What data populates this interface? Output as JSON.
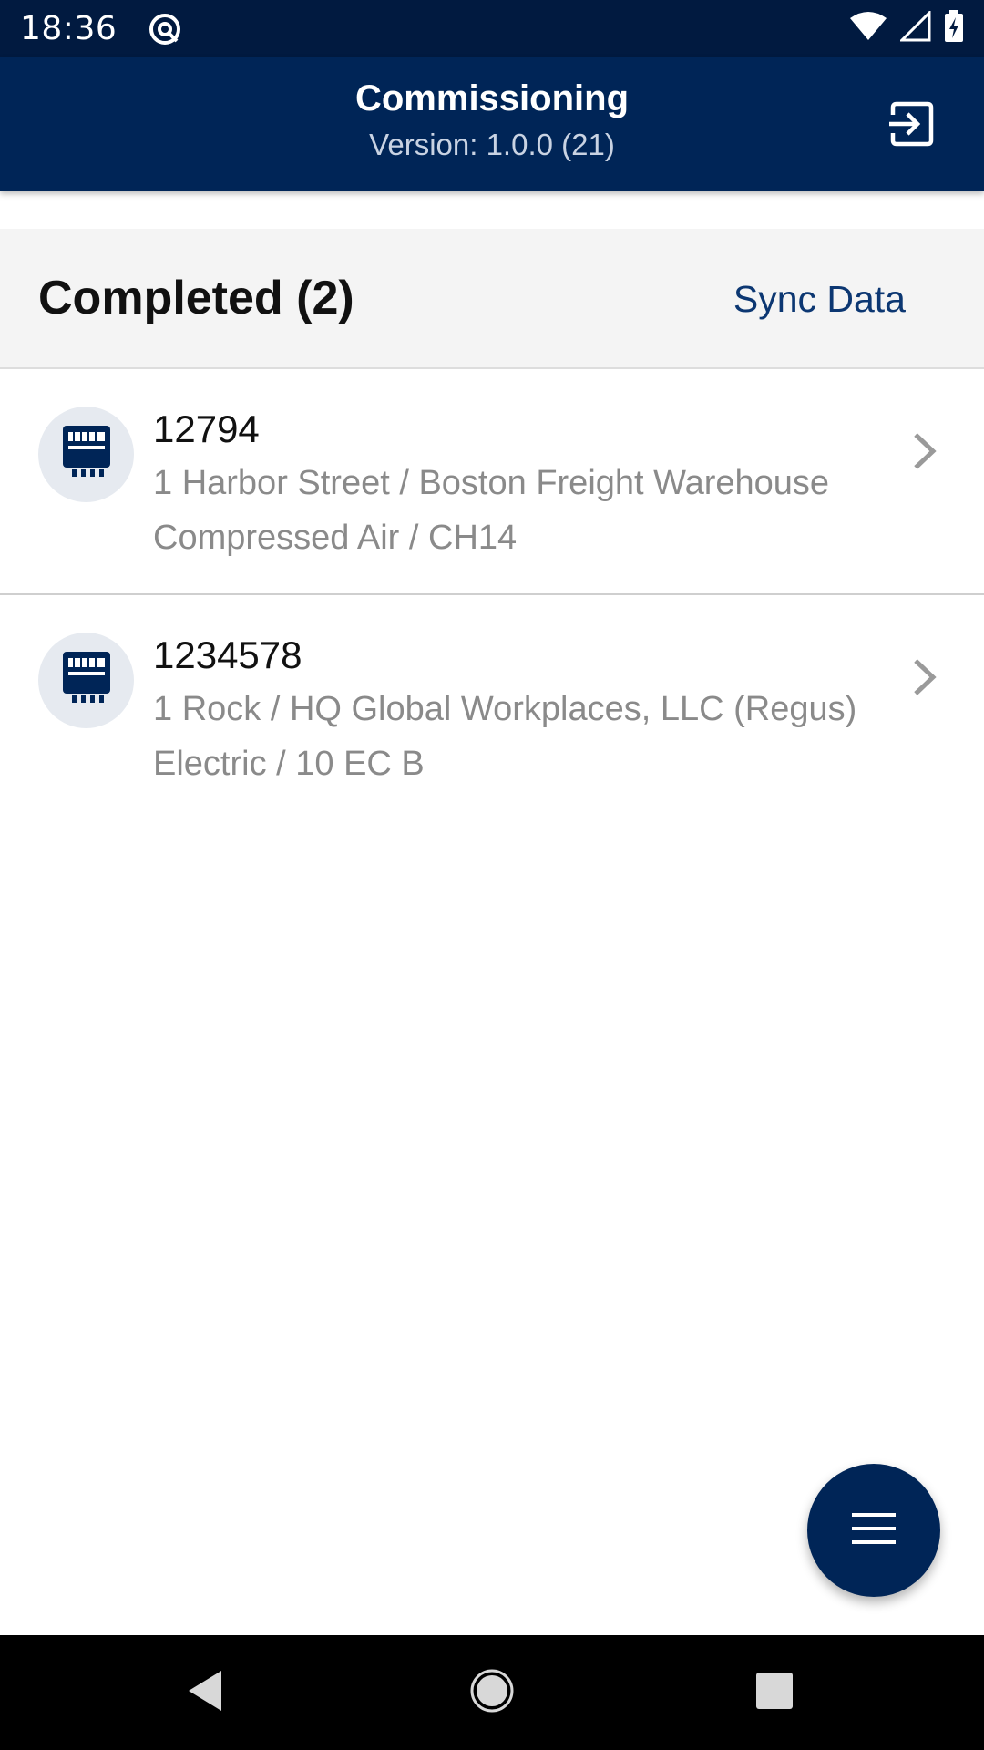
{
  "status_bar": {
    "time": "18:36",
    "icons": [
      "app-notification-icon",
      "wifi-icon",
      "cellular-signal-icon",
      "battery-charging-icon"
    ]
  },
  "app_bar": {
    "title": "Commissioning",
    "subtitle": "Version: 1.0.0 (21)",
    "action_icon": "logout-icon",
    "background": "#002557"
  },
  "section": {
    "title": "Completed (2)",
    "sync_label": "Sync Data"
  },
  "list": {
    "items": [
      {
        "title": "12794",
        "line1": "1 Harbor Street / Boston Freight Warehouse",
        "line2": "Compressed Air / CH14",
        "icon": "meter-icon"
      },
      {
        "title": "1234578",
        "line1": "1 Rock / HQ Global Workplaces, LLC (Regus)",
        "line2": "Electric / 10 EC B",
        "icon": "meter-icon"
      }
    ]
  },
  "fab": {
    "icon": "menu-icon"
  },
  "nav_bar": {
    "icons": [
      "back-icon",
      "home-icon",
      "recents-icon"
    ]
  },
  "colors": {
    "status_bar": "#011a40",
    "primary": "#002557",
    "link": "#0c3772",
    "secondary_text": "#8a8a8a",
    "section_bg": "#f4f4f4"
  }
}
